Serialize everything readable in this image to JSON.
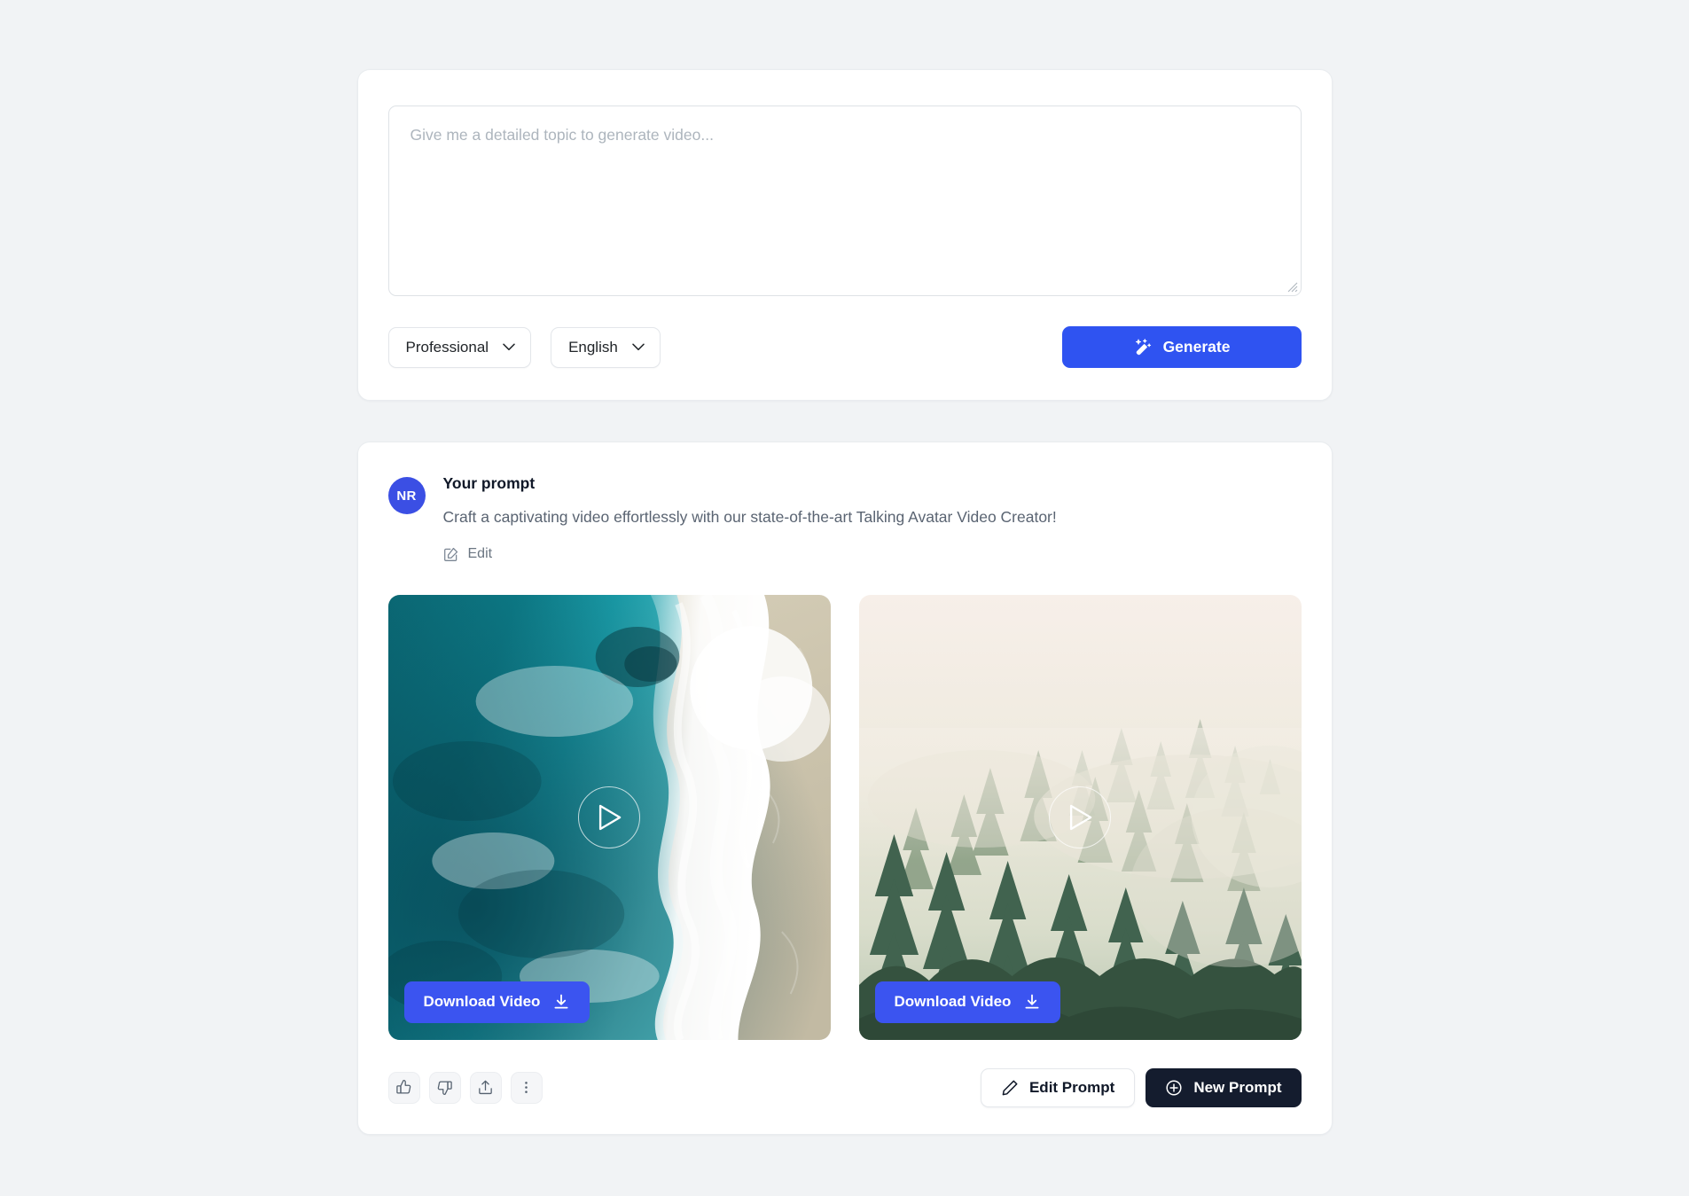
{
  "composer": {
    "placeholder": "Give me a detailed topic to generate video...",
    "value": "",
    "tone_select": {
      "value": "Professional",
      "icon": "chevron-down-icon"
    },
    "language_select": {
      "value": "English",
      "icon": "chevron-down-icon"
    },
    "generate": {
      "label": "Generate",
      "icon": "magic-wand-icon",
      "color": "#2f53f1"
    }
  },
  "result": {
    "avatar_initials": "NR",
    "avatar_color": "#3b4fe4",
    "prompt_title": "Your prompt",
    "prompt_text": "Craft a captivating video effortlessly with our state-of-the-art Talking Avatar Video Creator!",
    "edit_link": {
      "label": "Edit",
      "icon": "edit-square-icon"
    },
    "videos": [
      {
        "scene": "aerial-ocean-beach",
        "download_label": "Download Video",
        "download_icon": "download-icon",
        "play_icon": "play-icon"
      },
      {
        "scene": "misty-pine-forest",
        "download_label": "Download Video",
        "download_icon": "download-icon",
        "play_icon": "play-icon"
      }
    ],
    "feedback_buttons": [
      {
        "name": "thumbs-up-icon"
      },
      {
        "name": "thumbs-down-icon"
      },
      {
        "name": "share-icon"
      },
      {
        "name": "more-options-icon"
      }
    ],
    "edit_prompt": {
      "label": "Edit Prompt",
      "icon": "pencil-icon"
    },
    "new_prompt": {
      "label": "New Prompt",
      "icon": "plus-circle-icon",
      "color": "#141c2e"
    }
  }
}
